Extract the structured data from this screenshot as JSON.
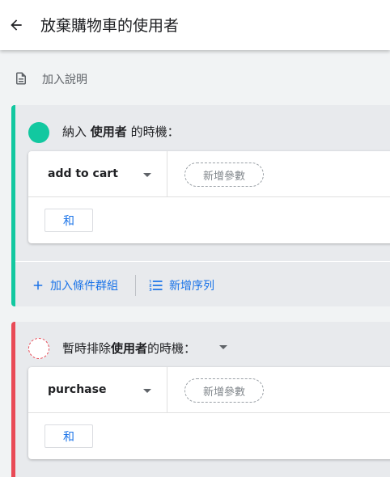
{
  "header": {
    "title": "放棄購物車的使用者",
    "back_icon": "arrow-back-icon"
  },
  "description": {
    "label": "加入說明",
    "icon": "document-icon"
  },
  "include_section": {
    "accent_color": "#12c8a0",
    "title_prefix": "納入 ",
    "title_bold": "使用者",
    "title_suffix": " 的時機：",
    "condition": {
      "event": "add to cart",
      "add_param_label": "新增參數",
      "and_label": "和"
    },
    "footer": {
      "add_group_label": "加入條件群組",
      "add_sequence_label": "新增序列"
    }
  },
  "exclude_section": {
    "accent_color": "#e94a56",
    "title_prefix": "暫時排除",
    "title_bold": "使用者",
    "title_suffix": "的時機：",
    "condition": {
      "event": "purchase",
      "add_param_label": "新增參數",
      "and_label": "和"
    }
  }
}
